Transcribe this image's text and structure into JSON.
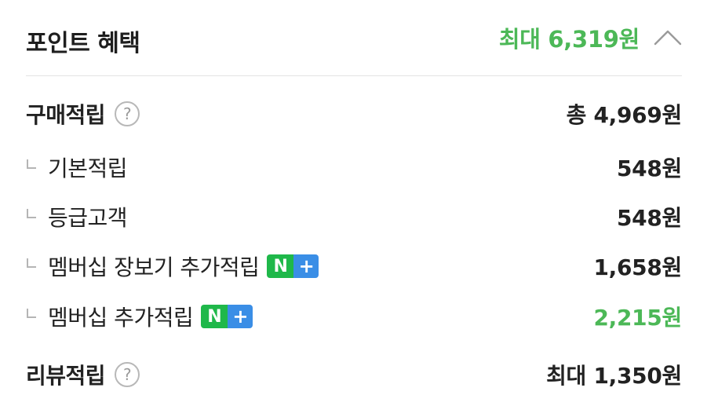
{
  "header": {
    "title": "포인트 혜택",
    "max_benefit": "최대 6,319원",
    "toggle_icon": "chevron-up-icon"
  },
  "rows": [
    {
      "label": "구매적립",
      "value": "총 4,969원",
      "type": "main",
      "help": true
    },
    {
      "label": "기본적립",
      "value": "548원",
      "type": "sub"
    },
    {
      "label": "등급고객",
      "value": "548원",
      "type": "sub"
    },
    {
      "label": "멤버십 장보기 추가적립",
      "value": "1,658원",
      "type": "sub",
      "badge": true
    },
    {
      "label": "멤버십 추가적립",
      "value": "2,215원",
      "type": "sub",
      "badge": true,
      "highlight": true
    },
    {
      "label": "리뷰적립",
      "value": "최대 1,350원",
      "type": "main",
      "help": true
    }
  ],
  "badge": {
    "n": "N",
    "plus": "+"
  },
  "help_icon_text": "?",
  "colors": {
    "accent": "#4cb857",
    "badge_n": "#1fb84a",
    "badge_plus": "#3a8ee6",
    "text": "#222222"
  }
}
